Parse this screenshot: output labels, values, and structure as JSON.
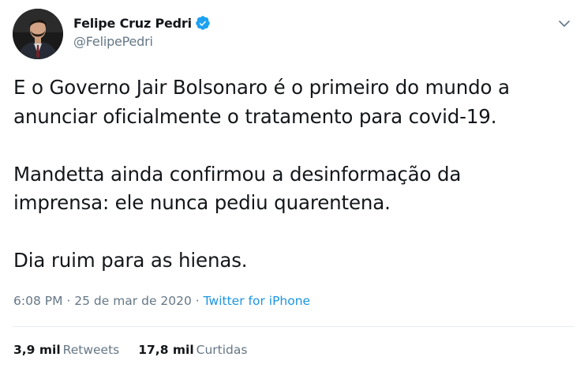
{
  "author": {
    "display_name": "Felipe Cruz Pedri",
    "handle": "@FelipePedri",
    "verified": true
  },
  "tweet": {
    "text": "E o Governo Jair Bolsonaro é o primeiro do mundo a\nanunciar oficialmente o tratamento para covid-19.\n\nMandetta ainda confirmou a desinformação da\nimprensa: ele nunca pediu quarentena.\n\nDia ruim para as hienas.",
    "time": "6:08 PM",
    "separator1": " · ",
    "date": "25 de mar de 2020",
    "separator2": " · ",
    "source": "Twitter for iPhone"
  },
  "stats": {
    "retweets_count": "3,9 mil",
    "retweets_label": "Retweets",
    "likes_count": "17,8 mil",
    "likes_label": "Curtidas"
  },
  "colors": {
    "verified": "#1da1f2",
    "link": "#1b95e0",
    "secondary_text": "#657786",
    "divider": "#e6ecf0"
  },
  "icons": {
    "verified": "verified-badge-icon",
    "menu": "chevron-down-icon"
  }
}
